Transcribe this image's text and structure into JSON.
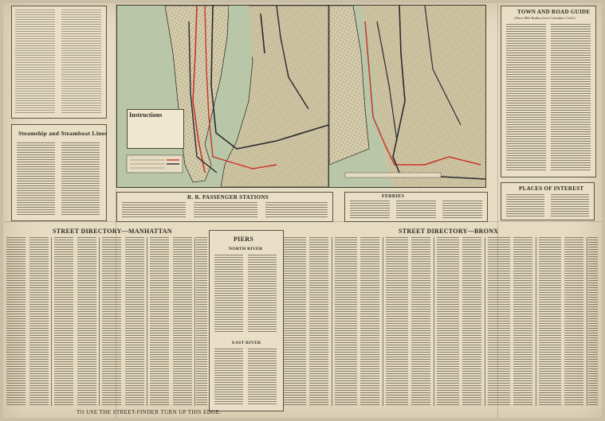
{
  "headings": {
    "steamship": "Steamship and Steamboat Lines",
    "town_road": "TOWN AND ROAD GUIDE",
    "town_road_sub": "(Show Mile Radius from Columbus Circle)",
    "places": "PLACES OF INTEREST",
    "rr_stations": "R. R. PASSENGER STATIONS",
    "ferries": "FERRIES",
    "street_manhattan": "STREET DIRECTORY—MANHATTAN",
    "street_bronx": "STREET DIRECTORY—BRONX",
    "piers": "PIERS",
    "north_river": "NORTH RIVER",
    "east_river": "EAST RIVER",
    "instructions": "Instructions",
    "bottom_note": "TO USE THE STREET-FINDER TURN UP THIS EDGE."
  },
  "colors": {
    "paper": "#e6dcc2",
    "map_land": "#d8cfae",
    "map_water": "#b9c7a8",
    "subway_red": "#c8352b",
    "subway_dark": "#2b2a30"
  }
}
